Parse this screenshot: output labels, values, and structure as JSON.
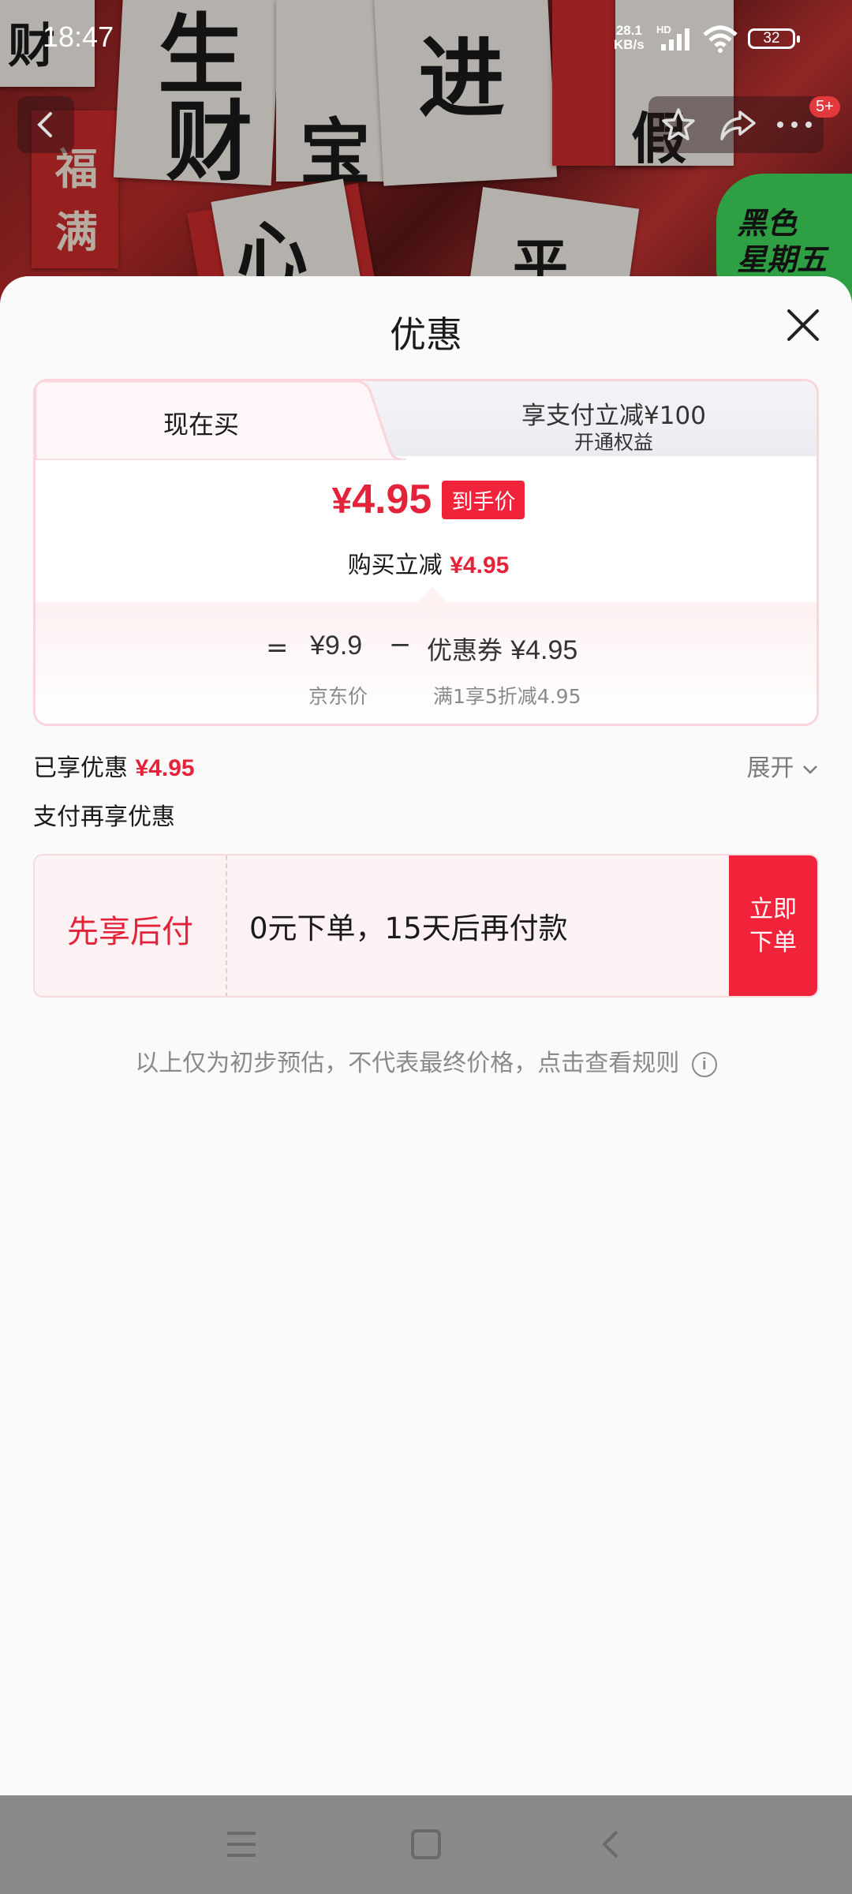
{
  "status_bar": {
    "time": "18:47",
    "speed_top": "28.1",
    "speed_bottom": "KB/s",
    "hd": "HD",
    "battery": "32"
  },
  "header": {
    "badge": "5+",
    "promo_text": [
      "黑色",
      "星期五"
    ]
  },
  "sheet": {
    "title": "优惠",
    "tabs": {
      "left": "现在买",
      "right": "享支付立减¥100",
      "right_sub": "开通权益"
    },
    "final": {
      "symbol": "¥",
      "amount": "4.95",
      "tag": "到手价"
    },
    "reduce": {
      "label": "购买立减",
      "value": "¥4.95"
    },
    "calc": {
      "eq": "=",
      "jd_price": "¥9.9",
      "minus": "−",
      "coupon_label": "优惠券",
      "coupon_value": "¥4.95",
      "jd_label": "京东价",
      "coupon_desc": "满1享5折减4.95"
    },
    "enjoyed": {
      "label": "已享优惠",
      "value": "¥4.95"
    },
    "expand": "展开",
    "pay_again": "支付再享优惠",
    "bnpl": {
      "title": "先享后付",
      "desc": "0元下单，15天后再付款",
      "button": "立即下单"
    },
    "note": "以上仅为初步预估，不代表最终价格，点击查看规则",
    "note_icon": "i"
  }
}
